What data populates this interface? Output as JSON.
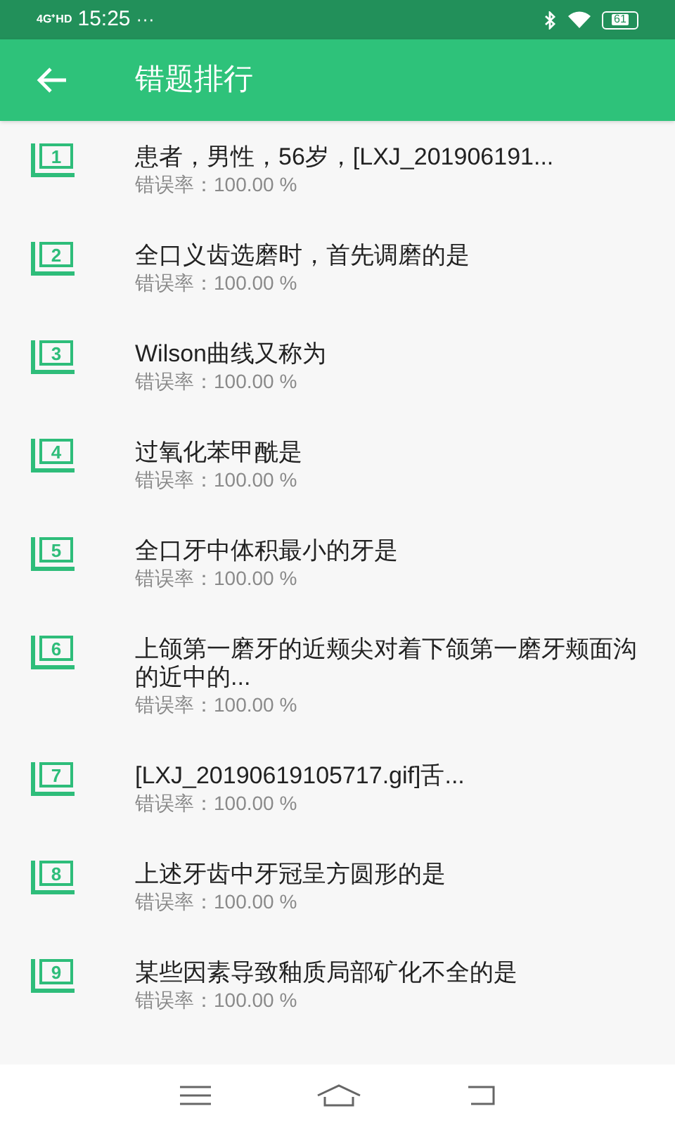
{
  "status_bar": {
    "network": "4G⁺HD",
    "time": "15:25",
    "more": "···",
    "battery": "61"
  },
  "header": {
    "title": "错题排行"
  },
  "items": [
    {
      "rank": "1",
      "title": "患者，男性，56岁，[LXJ_201906191...",
      "rate": "错误率：100.00 %"
    },
    {
      "rank": "2",
      "title": "全口义齿选磨时，首先调磨的是",
      "rate": "错误率：100.00 %"
    },
    {
      "rank": "3",
      "title": "Wilson曲线又称为",
      "rate": "错误率：100.00 %"
    },
    {
      "rank": "4",
      "title": "过氧化苯甲酰是",
      "rate": "错误率：100.00 %"
    },
    {
      "rank": "5",
      "title": "全口牙中体积最小的牙是",
      "rate": "错误率：100.00 %"
    },
    {
      "rank": "6",
      "title": "上颌第一磨牙的近颊尖对着下颌第一磨牙颊面沟的近中的...",
      "rate": "错误率：100.00 %"
    },
    {
      "rank": "7",
      "title": "[LXJ_20190619105717.gif]舌...",
      "rate": "错误率：100.00 %"
    },
    {
      "rank": "8",
      "title": "上述牙齿中牙冠呈方圆形的是",
      "rate": "错误率：100.00 %"
    },
    {
      "rank": "9",
      "title": "某些因素导致釉质局部矿化不全的是",
      "rate": "错误率：100.00 %"
    }
  ]
}
